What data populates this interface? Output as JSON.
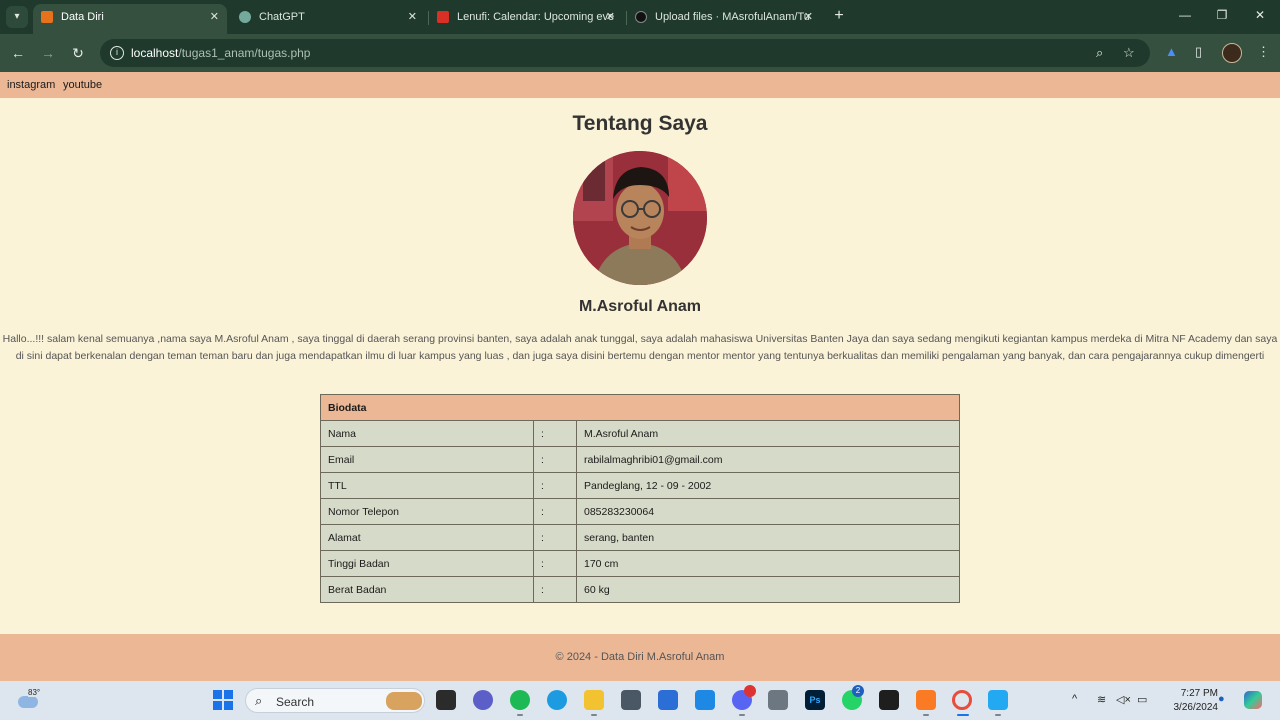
{
  "browser": {
    "tabs": [
      {
        "title": "Data Diri",
        "active": true,
        "favicon_color": "#e8711c"
      },
      {
        "title": "ChatGPT",
        "active": false,
        "favicon_color": "#74aa9c"
      },
      {
        "title": "Lenufi: Calendar: Upcoming eve",
        "active": false,
        "favicon_color": "#d93025"
      },
      {
        "title": "Upload files · MAsrofulAnam/Tu",
        "active": false,
        "favicon_color": "#111111"
      }
    ],
    "url_host": "localhost",
    "url_path": "/tugas1_anam/tugas.php"
  },
  "nav": {
    "links": [
      "instagram",
      "youtube"
    ]
  },
  "page": {
    "title": "Tentang Saya",
    "name": "M.Asroful Anam",
    "about": "Hallo...!!! salam kenal semuanya ,nama saya M.Asroful Anam , saya tinggal di daerah serang provinsi banten, saya adalah anak tunggal, saya adalah mahasiswa Universitas Banten Jaya dan saya sedang mengikuti kegiantan kampus merdeka di Mitra NF Academy dan saya di sini dapat berkenalan dengan teman teman baru dan juga mendapatkan ilmu di luar kampus yang luas , dan juga saya disini bertemu dengan mentor mentor yang tentunya berkualitas dan memiliki pengalaman yang banyak, dan cara pengajarannya cukup dimengerti"
  },
  "biodata": {
    "header": "Biodata",
    "separator": ":",
    "rows": [
      {
        "label": "Nama",
        "value": "M.Asroful Anam"
      },
      {
        "label": "Email",
        "value": "rabilalmaghribi01@gmail.com"
      },
      {
        "label": "TTL",
        "value": "Pandeglang, 12 - 09 - 2002"
      },
      {
        "label": "Nomor Telepon",
        "value": "085283230064"
      },
      {
        "label": "Alamat",
        "value": "serang, banten"
      },
      {
        "label": "Tinggi Badan",
        "value": "170 cm"
      },
      {
        "label": "Berat Badan",
        "value": "60 kg"
      }
    ]
  },
  "footer": {
    "text": "© 2024 - Data Diri M.Asroful Anam"
  },
  "taskbar": {
    "weather_temp": "83°",
    "search_label": "Search",
    "time": "7:27 PM",
    "date": "3/26/2024",
    "badge_discord": "",
    "badge_whatsapp": "2"
  },
  "colors": {
    "page_bg": "#fbf3d8",
    "accent": "#ebb795",
    "table_cell": "#d6dac8",
    "chrome_dark": "#1f3a2c"
  }
}
